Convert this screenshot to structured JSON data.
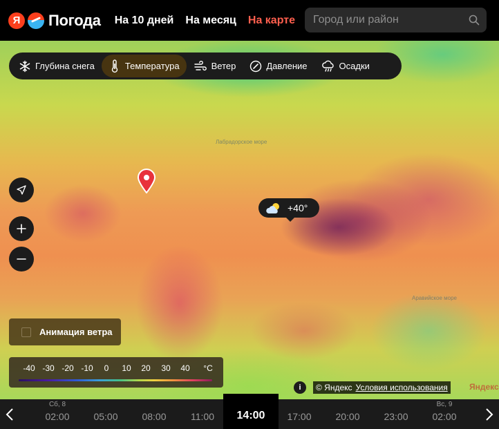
{
  "header": {
    "logo_letter": "Я",
    "logo_text": "Погода",
    "nav": [
      {
        "label": "На 10 дней",
        "active": false
      },
      {
        "label": "На месяц",
        "active": false
      },
      {
        "label": "На карте",
        "active": true
      }
    ],
    "search_placeholder": "Город или район"
  },
  "layers": [
    {
      "label": "Глубина снега",
      "icon": "snowflake-icon",
      "active": false
    },
    {
      "label": "Температура",
      "icon": "thermometer-icon",
      "active": true
    },
    {
      "label": "Ветер",
      "icon": "wind-icon",
      "active": false
    },
    {
      "label": "Давление",
      "icon": "pressure-gauge-icon",
      "active": false
    },
    {
      "label": "Осадки",
      "icon": "rain-cloud-icon",
      "active": false
    }
  ],
  "map": {
    "temp_marker": "+40°",
    "temp_marker_icon": "partly-cloudy-icon",
    "labels": [
      "Лабрадорское море",
      "Аравийское море"
    ]
  },
  "controls": {
    "wind_animation_label": "Анимация ветра",
    "wind_animation_checked": false
  },
  "legend": {
    "ticks": [
      "-40",
      "-30",
      "-20",
      "-10",
      "0",
      "10",
      "20",
      "30",
      "40"
    ],
    "unit": "°C"
  },
  "attribution": {
    "info": "i",
    "copyright": "© Яндекс",
    "terms_link": "Условия использования",
    "brand": "Яндекс"
  },
  "timeline": {
    "slots": [
      {
        "day": "Сб, 8",
        "time": "02:00",
        "active": false
      },
      {
        "day": "",
        "time": "05:00",
        "active": false
      },
      {
        "day": "",
        "time": "08:00",
        "active": false
      },
      {
        "day": "",
        "time": "11:00",
        "active": false
      },
      {
        "day": "",
        "time": "14:00",
        "active": true
      },
      {
        "day": "",
        "time": "17:00",
        "active": false
      },
      {
        "day": "",
        "time": "20:00",
        "active": false
      },
      {
        "day": "",
        "time": "23:00",
        "active": false
      },
      {
        "day": "Вс, 9",
        "time": "02:00",
        "active": false
      }
    ]
  },
  "colors": {
    "accent": "#ff5f4e",
    "active_layer_bg": "#473410",
    "pin": "#e8323c"
  }
}
